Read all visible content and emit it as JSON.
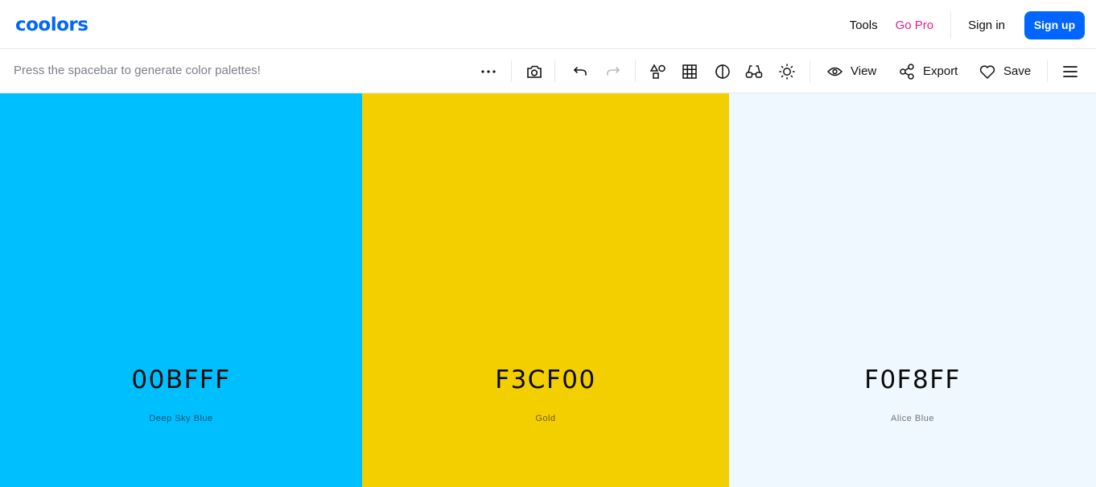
{
  "brand": {
    "logo_text": "coolors",
    "accent": "#0066ff"
  },
  "nav": {
    "tools": "Tools",
    "go_pro": "Go Pro",
    "sign_in": "Sign in",
    "sign_up": "Sign up"
  },
  "toolbar": {
    "hint": "Press the spacebar to generate color palettes!",
    "view_label": "View",
    "export_label": "Export",
    "save_label": "Save",
    "icons": [
      "more-icon",
      "camera-icon",
      "undo-icon",
      "redo-icon",
      "shapes-icon",
      "grid-icon",
      "contrast-icon",
      "glasses-icon",
      "sun-icon",
      "eye-icon",
      "share-icon",
      "heart-icon",
      "menu-icon"
    ]
  },
  "palette": [
    {
      "hex": "00BFFF",
      "name": "Deep Sky Blue",
      "color": "#00BFFF"
    },
    {
      "hex": "F3CF00",
      "name": "Gold",
      "color": "#F3CF00"
    },
    {
      "hex": "F0F8FF",
      "name": "Alice Blue",
      "color": "#F0F8FF"
    }
  ]
}
